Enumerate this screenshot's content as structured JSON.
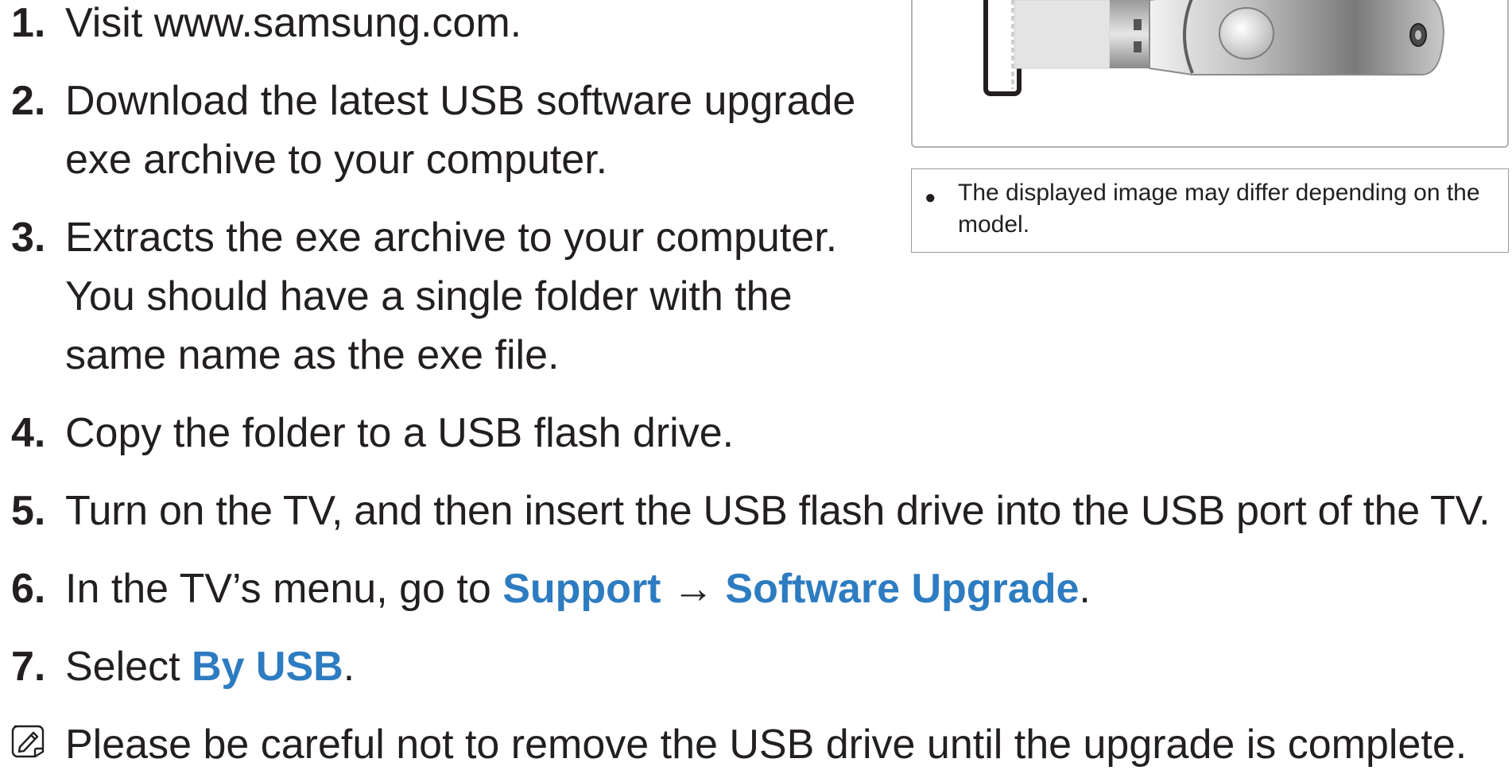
{
  "steps": [
    {
      "num": "1.",
      "lines": [
        "Visit www.samsung.com."
      ]
    },
    {
      "num": "2.",
      "lines": [
        "Download the latest USB software upgrade",
        "exe archive to your computer."
      ]
    },
    {
      "num": "3.",
      "lines": [
        "Extracts the exe archive to your computer.",
        "You should have a single folder with the",
        "same name as the exe file."
      ]
    },
    {
      "num": "4.",
      "lines": [
        "Copy the folder to a USB flash drive."
      ]
    },
    {
      "num": "5.",
      "lines": [
        "Turn on the TV, and then insert the USB flash drive into the USB port of the TV."
      ]
    },
    {
      "num": "6.",
      "prefix": "In the TV’s menu, go to ",
      "link1": "Support",
      "arrow": " → ",
      "link2": "Software Upgrade",
      "suffix": "."
    },
    {
      "num": "7.",
      "prefix": "Select ",
      "link1": "By USB",
      "suffix": "."
    }
  ],
  "note": {
    "text": "Please be careful not to remove the USB drive until the upgrade is complete.",
    "icon": "note-icon"
  },
  "figure": {
    "caption_bullet": "●",
    "caption_lines": [
      "The displayed image may differ depending on the",
      "model."
    ]
  },
  "colors": {
    "text": "#231f20",
    "highlight": "#2d7cc1",
    "border": "#b3b3b3"
  }
}
